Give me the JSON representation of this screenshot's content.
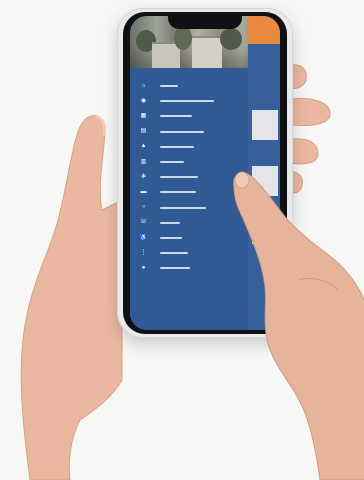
{
  "menu": {
    "items": [
      {
        "icon": "home-icon",
        "glyph": "⌂"
      },
      {
        "icon": "eye-icon",
        "glyph": "◉"
      },
      {
        "icon": "calendar-icon",
        "glyph": "▦"
      },
      {
        "icon": "document-icon",
        "glyph": "▤"
      },
      {
        "icon": "mountain-icon",
        "glyph": "▲"
      },
      {
        "icon": "building-icon",
        "glyph": "▥"
      },
      {
        "icon": "gear-icon",
        "glyph": "✻"
      },
      {
        "icon": "bed-icon",
        "glyph": "▬"
      },
      {
        "icon": "info-icon",
        "glyph": "○"
      },
      {
        "icon": "phone-icon",
        "glyph": "☏"
      },
      {
        "icon": "accessibility-icon",
        "glyph": "♿"
      },
      {
        "icon": "share-icon",
        "glyph": "⋮"
      },
      {
        "icon": "globe-icon",
        "glyph": "●"
      }
    ]
  },
  "colors": {
    "menu_background": "#2f5a93",
    "accent_orange": "#e8893f",
    "page_background": "#f7f7f6"
  }
}
